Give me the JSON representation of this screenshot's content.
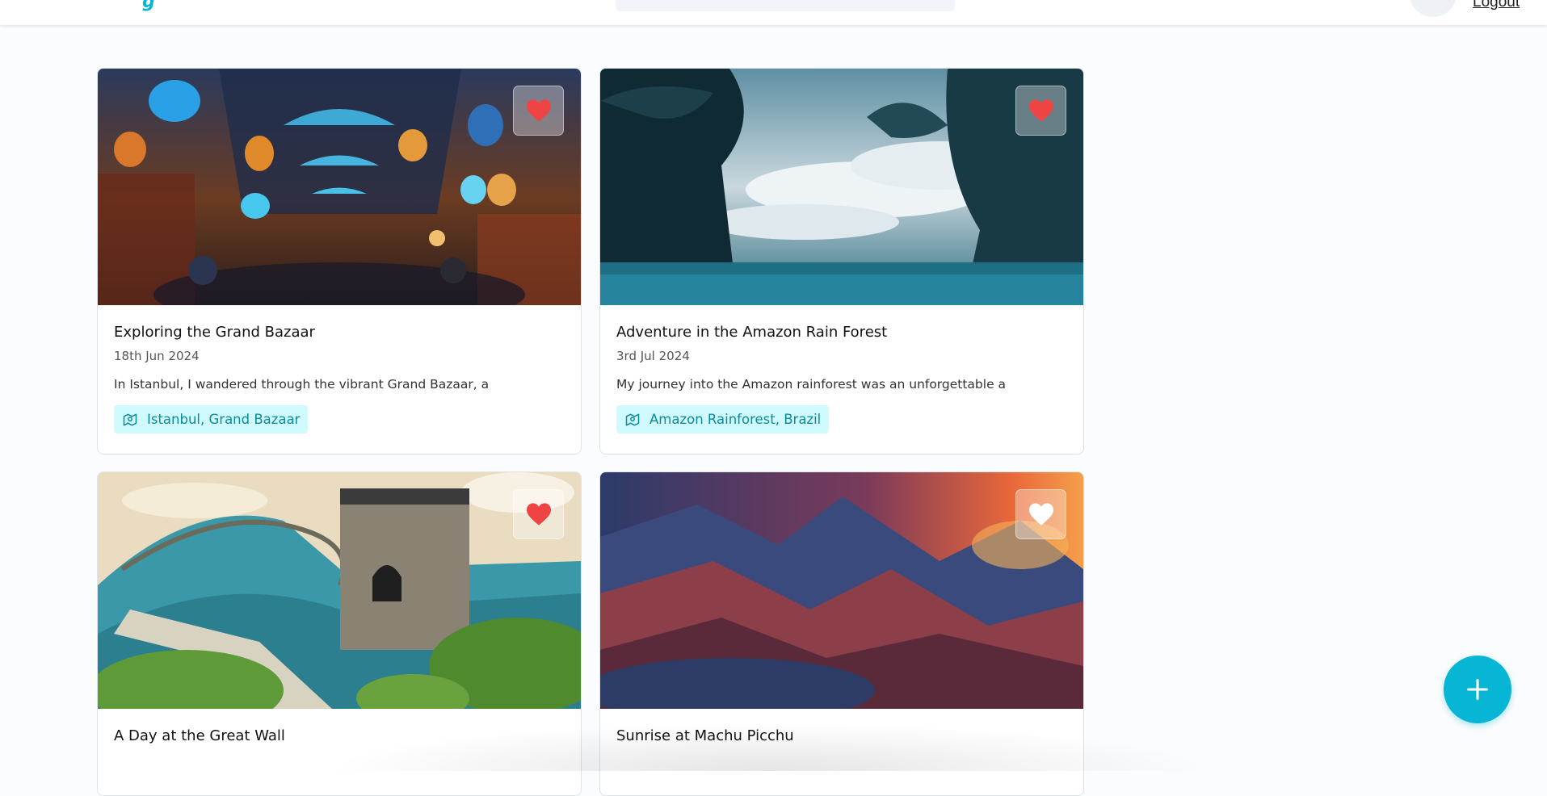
{
  "header": {
    "logo_text": "g",
    "logout_label": "Logout"
  },
  "stories": [
    {
      "title": "Exploring the Grand Bazaar",
      "date": "18th Jun 2024",
      "excerpt": "In Istanbul, I wandered through the vibrant Grand Bazaar, a",
      "location": "Istanbul, Grand Bazaar",
      "favorite": true
    },
    {
      "title": "Adventure in the Amazon Rain Forest",
      "date": "3rd Jul 2024",
      "excerpt": "My journey into the Amazon rainforest was an unforgettable a",
      "location": "Amazon Rainforest, Brazil",
      "favorite": true
    },
    {
      "title": "A Day at the Great Wall",
      "favorite": true
    },
    {
      "title": "Sunrise at Machu Picchu",
      "favorite": false
    }
  ],
  "icons": {
    "heart_active": "#ef4444",
    "heart_inactive": "#ffffff",
    "fab": "plus-icon",
    "tag": "map-icon"
  },
  "colors": {
    "accent": "#06b6d4",
    "tag_bg": "#cffafe",
    "tag_text": "#0e8b99"
  }
}
